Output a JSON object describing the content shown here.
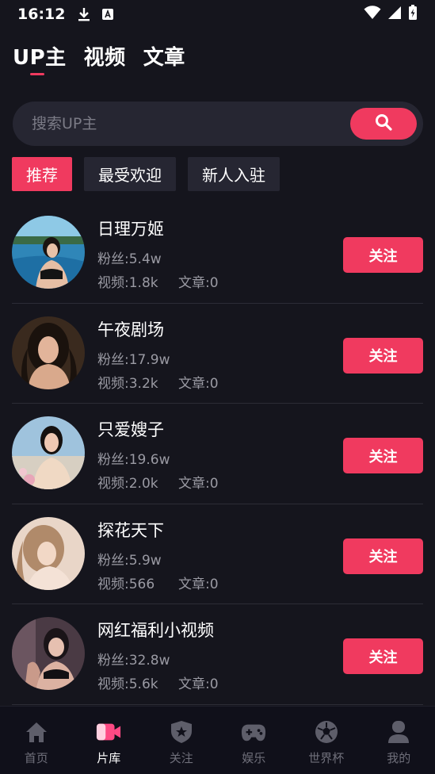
{
  "status_bar": {
    "time": "16:12"
  },
  "top_tabs": [
    {
      "label": "UP主",
      "active": true
    },
    {
      "label": "视频",
      "active": false
    },
    {
      "label": "文章",
      "active": false
    }
  ],
  "search": {
    "placeholder": "搜索UP主"
  },
  "filters": [
    {
      "label": "推荐",
      "active": true
    },
    {
      "label": "最受欢迎",
      "active": false
    },
    {
      "label": "新人入驻",
      "active": false
    }
  ],
  "up_list": [
    {
      "name": "日理万姬",
      "fans": "粉丝:5.4w",
      "videos": "视频:1.8k",
      "articles": "文章:0",
      "follow_label": "关注"
    },
    {
      "name": "午夜剧场",
      "fans": "粉丝:17.9w",
      "videos": "视频:3.2k",
      "articles": "文章:0",
      "follow_label": "关注"
    },
    {
      "name": "只爱嫂子",
      "fans": "粉丝:19.6w",
      "videos": "视频:2.0k",
      "articles": "文章:0",
      "follow_label": "关注"
    },
    {
      "name": "探花天下",
      "fans": "粉丝:5.9w",
      "videos": "视频:566",
      "articles": "文章:0",
      "follow_label": "关注"
    },
    {
      "name": "网红福利小视频",
      "fans": "粉丝:32.8w",
      "videos": "视频:5.6k",
      "articles": "文章:0",
      "follow_label": "关注"
    }
  ],
  "bottom_nav": [
    {
      "label": "首页",
      "icon": "home-icon",
      "active": false
    },
    {
      "label": "片库",
      "icon": "video-camera-icon",
      "active": true
    },
    {
      "label": "关注",
      "icon": "shield-star-icon",
      "active": false
    },
    {
      "label": "娱乐",
      "icon": "gamepad-icon",
      "active": false
    },
    {
      "label": "世界杯",
      "icon": "soccer-ball-icon",
      "active": false
    },
    {
      "label": "我的",
      "icon": "user-icon",
      "active": false
    }
  ],
  "colors": {
    "accent": "#f03a5f",
    "background": "#15151d",
    "surface": "#262632"
  }
}
